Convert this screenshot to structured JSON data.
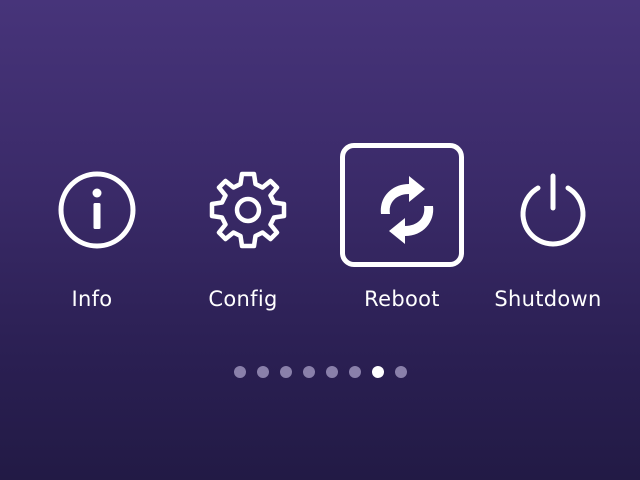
{
  "menu": {
    "items": [
      {
        "label": "Info",
        "icon": "info-icon",
        "selected": false
      },
      {
        "label": "Config",
        "icon": "gear-icon",
        "selected": false
      },
      {
        "label": "Reboot",
        "icon": "reboot-icon",
        "selected": true
      },
      {
        "label": "Shutdown",
        "icon": "power-icon",
        "selected": false
      }
    ]
  },
  "pagination": {
    "total_pages": 8,
    "current_page": 7
  },
  "colors": {
    "background_top": "#47347a",
    "background_bottom": "#221a45",
    "foreground": "#ffffff",
    "dot_inactive": "#8a80aa"
  }
}
